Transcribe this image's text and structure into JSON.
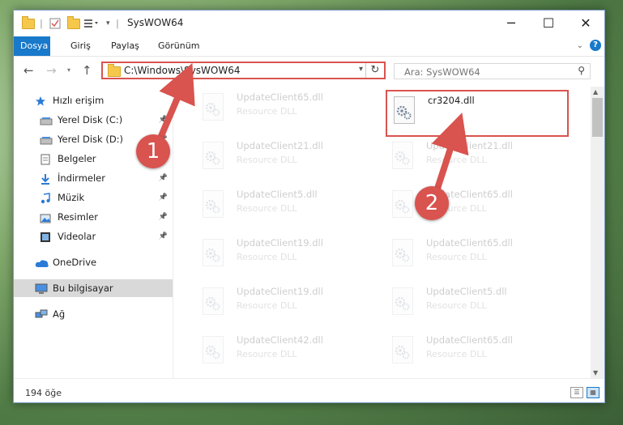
{
  "titlebar": {
    "title": "SysWOW64",
    "minimize": "─",
    "maximize": "☐",
    "close": "✕"
  },
  "ribbon": {
    "tabs": [
      {
        "label": "Dosya",
        "active": true
      },
      {
        "label": "Giriş",
        "active": false
      },
      {
        "label": "Paylaş",
        "active": false
      },
      {
        "label": "Görünüm",
        "active": false
      }
    ],
    "help": "?"
  },
  "navbar": {
    "back": "←",
    "forward": "→",
    "up": "↑",
    "address": "C:\\Windows\\SysWOW64",
    "search_placeholder": "Ara: SysWOW64"
  },
  "sidebar": {
    "items": [
      {
        "label": "Hızlı erişim",
        "icon": "star-icon",
        "pinned": false
      },
      {
        "label": "Yerel Disk (C:)",
        "icon": "drive-icon",
        "pinned": true
      },
      {
        "label": "Yerel Disk (D:)",
        "icon": "drive-icon",
        "pinned": true
      },
      {
        "label": "Belgeler",
        "icon": "documents-icon",
        "pinned": true
      },
      {
        "label": "İndirmeler",
        "icon": "download-icon",
        "pinned": true
      },
      {
        "label": "Müzik",
        "icon": "music-icon",
        "pinned": true
      },
      {
        "label": "Resimler",
        "icon": "pictures-icon",
        "pinned": true
      },
      {
        "label": "Videolar",
        "icon": "video-icon",
        "pinned": true
      },
      {
        "label": "OneDrive",
        "icon": "cloud-icon",
        "pinned": false
      },
      {
        "label": "Bu bilgisayar",
        "icon": "computer-icon",
        "pinned": false,
        "selected": true
      },
      {
        "label": "Ağ",
        "icon": "network-icon",
        "pinned": false
      }
    ]
  },
  "files": [
    {
      "name": "UpdateClient65.dll",
      "type": "Resource DLL",
      "faded": true
    },
    {
      "name": "cr3204.dll",
      "type": "",
      "faded": false,
      "highlighted": true
    },
    {
      "name": "UpdateClient21.dll",
      "type": "Resource DLL",
      "faded": true
    },
    {
      "name": "UpdateClient21.dll",
      "type": "Resource DLL",
      "faded": true
    },
    {
      "name": "UpdateClient5.dll",
      "type": "Resource DLL",
      "faded": true
    },
    {
      "name": "UpdateClient65.dll",
      "type": "Resource DLL",
      "faded": true
    },
    {
      "name": "UpdateClient19.dll",
      "type": "Resource DLL",
      "faded": true
    },
    {
      "name": "UpdateClient65.dll",
      "type": "Resource DLL",
      "faded": true
    },
    {
      "name": "UpdateClient19.dll",
      "type": "Resource DLL",
      "faded": true
    },
    {
      "name": "UpdateClient5.dll",
      "type": "Resource DLL",
      "faded": true
    },
    {
      "name": "UpdateClient42.dll",
      "type": "Resource DLL",
      "faded": true
    },
    {
      "name": "UpdateClient65.dll",
      "type": "Resource DLL",
      "faded": true
    },
    {
      "name": "",
      "type": "",
      "faded": true
    },
    {
      "name": "",
      "type": "",
      "faded": true
    }
  ],
  "status": {
    "count": "194 öğe"
  },
  "annotations": {
    "badge_1": "1",
    "badge_2": "2",
    "color": "#d9534f"
  },
  "colors": {
    "accent": "#1979ca",
    "highlight": "#d9534f"
  }
}
